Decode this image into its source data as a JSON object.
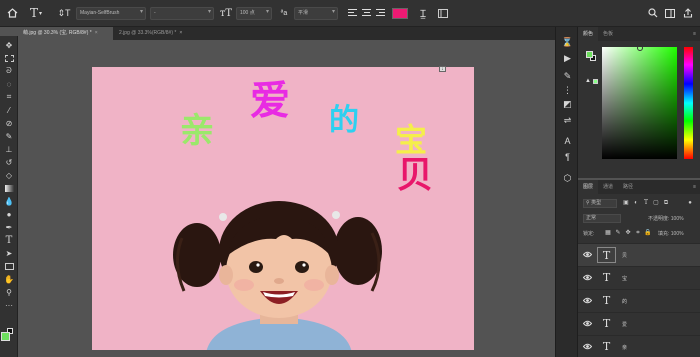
{
  "options_bar": {
    "home_icon": "home-icon",
    "tool_icon": "type-tool-icon",
    "orient_icon": "text-orientation-icon",
    "font_family": "Mayian-SelfBrush",
    "font_style": "-",
    "size_icon": "font-size-icon",
    "font_size": "100 点",
    "aa_icon": "anti-alias-icon",
    "anti_alias": "平滑",
    "text_color": "#ec1a73",
    "warp_icon": "warp-text-icon",
    "panel_icon": "character-panel-icon",
    "search_icon": "search-icon",
    "workspace_icon": "workspace-icon",
    "share_icon": "share-icon"
  },
  "tabs": [
    {
      "label": "萌.jpg @ 30.3% (宝, RGB/8#) *",
      "active": true
    },
    {
      "label": "2.jpg @ 33.3%(RGB/8#) *",
      "active": false
    }
  ],
  "canvas": {
    "background": "#f0b3c6",
    "chars": [
      {
        "text": "亲",
        "color": "#9be86b"
      },
      {
        "text": "爱",
        "color": "#e82be3"
      },
      {
        "text": "的",
        "color": "#2ed0f0"
      },
      {
        "text": "宝",
        "color": "#f5ef4a"
      },
      {
        "text": "贝",
        "color": "#e8166a"
      }
    ]
  },
  "color_panel": {
    "tabs": [
      "颜色",
      "色板"
    ],
    "foreground": "#6dde5e",
    "background": "#111111"
  },
  "layers_panel": {
    "tabs": [
      "图层",
      "通道",
      "路径"
    ],
    "filter_label": "类型",
    "blend_mode": "正常",
    "opacity_label": "不透明度: 100%",
    "lock_label": "锁定:",
    "fill_label": "填充: 100%",
    "layers": [
      {
        "name": "贝",
        "selected": true
      },
      {
        "name": "宝",
        "selected": false
      },
      {
        "name": "的",
        "selected": false
      },
      {
        "name": "爱",
        "selected": false
      },
      {
        "name": "亲",
        "selected": false
      }
    ]
  }
}
